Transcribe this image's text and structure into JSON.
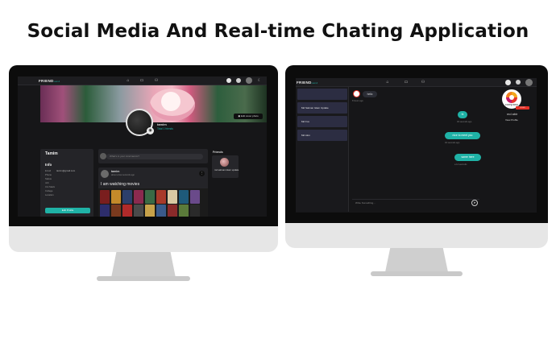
{
  "headline": "Social Media And Real-time Chating Application",
  "left_screen": {
    "brand": "FRIEND",
    "brand_sub": "Land",
    "nav_icons": [
      "home-icon",
      "video-icon",
      "group-icon"
    ],
    "edit_cover_label": "Edit cover photo",
    "profile": {
      "name": "tamim",
      "subtitle": "Total 1 friends"
    },
    "info_card": {
      "user": "Tamim",
      "heading": "Info",
      "rows": [
        {
          "label": "Email",
          "value": "tamim@gmail.com"
        },
        {
          "label": "Phone",
          "value": ""
        },
        {
          "label": "Status",
          "value": ""
        },
        {
          "label": "Job",
          "value": ""
        },
        {
          "label": "Uni Stack",
          "value": ""
        },
        {
          "label": "College",
          "value": ""
        },
        {
          "label": "Location",
          "value": ""
        }
      ],
      "edit_button": "Edit Profile"
    },
    "post_input_placeholder": "What's in your mind tamim?",
    "post": {
      "user": "tamim",
      "time": "about a few seconds ago",
      "text": "I am watching movies"
    },
    "friends": {
      "title": "Friends",
      "items": [
        {
          "name": "md salman islam update"
        }
      ]
    },
    "colors": {
      "accent": "#1fb2a6",
      "panel": "#242428",
      "bg": "#161618"
    }
  },
  "right_screen": {
    "brand": "FRIEND",
    "brand_sub": "Land",
    "chat_list": [
      {
        "label": ""
      },
      {
        "label": "Md Salman Islam Update"
      },
      {
        "label": "Md Fox"
      },
      {
        "label": "Md Alon"
      }
    ],
    "messages": [
      {
        "side": "in",
        "text": "hello",
        "time": "8 hours ago"
      },
      {
        "side": "out",
        "text": "hi",
        "time": "30 seconds ago"
      },
      {
        "side": "out",
        "text": "nice to meet you",
        "time": "40 seconds ago"
      },
      {
        "side": "out",
        "text": "same here",
        "time": "a 14 seconds"
      }
    ],
    "composer_placeholder": "Write Something...",
    "contact": {
      "logo_word": "company",
      "logo_tag": "LOGO",
      "name": "md abir",
      "view_profile": "View Profile"
    },
    "colors": {
      "accent": "#1fb2a6",
      "chat_item": "#2c2d42"
    }
  }
}
